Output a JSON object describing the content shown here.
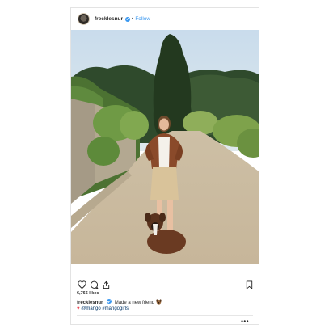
{
  "post": {
    "username": "frecklesnur",
    "follow_label": "Follow",
    "separator": "•",
    "likes": "6,766 likes",
    "caption": {
      "username": "frecklesnur",
      "text": "Made a new friend"
    },
    "tags": "@mango #mangogirls",
    "more_label": "•••"
  },
  "icons": {
    "like": "heart-outline-icon",
    "comment": "speech-bubble-icon",
    "share": "share-arrow-icon",
    "save": "bookmark-icon",
    "verified": "verified-badge-icon",
    "caption_emoji": "dog-face-emoji",
    "tag_emoji": "red-heart-emoji"
  },
  "colors": {
    "link_blue": "#3897f0",
    "hashtag": "#003569",
    "heart_red": "#ed4956"
  }
}
